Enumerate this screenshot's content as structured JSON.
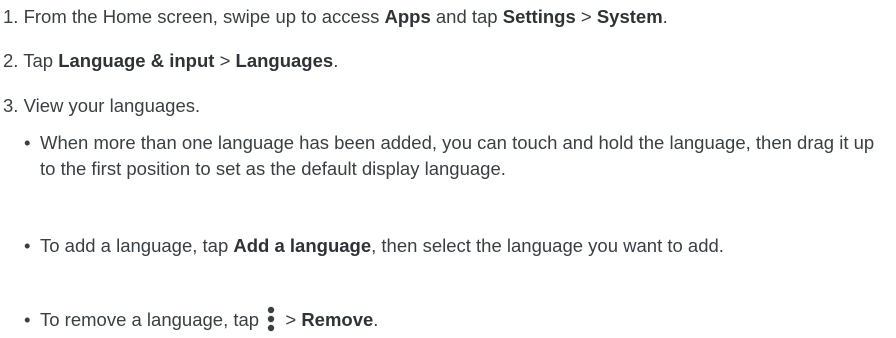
{
  "steps": [
    {
      "num": "1.",
      "parts": [
        "From the Home screen, swipe up to access ",
        "Apps",
        " and tap ",
        "Settings",
        " > ",
        "System",
        "."
      ]
    },
    {
      "num": "2.",
      "parts": [
        "Tap ",
        "Language & input",
        " > ",
        "Languages",
        "."
      ]
    },
    {
      "num": "3.",
      "parts": [
        "View your languages."
      ]
    }
  ],
  "bullets": [
    {
      "parts": [
        "When more than one language has been added, you can touch and hold the language, then drag it up to the first position to set as the default display language."
      ]
    },
    {
      "parts": [
        "To add a language, tap ",
        "Add a language",
        ", then select the language you want to add."
      ]
    },
    {
      "parts": [
        "To remove a language, tap ",
        " > ",
        "Remove",
        "."
      ],
      "icon": "more-vert-icon"
    }
  ],
  "colors": {
    "text": "#3a3f44",
    "bold": "#2f3337"
  }
}
